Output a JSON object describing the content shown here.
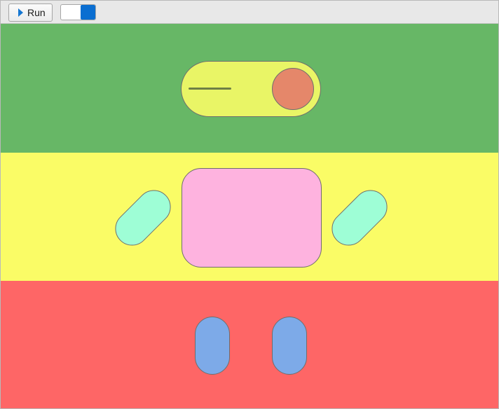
{
  "toolbar": {
    "run_label": "Run",
    "run_icon": "play-icon",
    "toggle_state": "on"
  },
  "colors": {
    "toolbar_bg": "#e8e8e8",
    "play_icon": "#1677d2",
    "toggle_knob": "#0a6ed1",
    "band_top": "#67b766",
    "band_middle": "#fafc66",
    "band_bottom": "#fe6666",
    "switch_body": "#e9f566",
    "switch_line": "#6f7f45",
    "switch_knob": "#e5876a",
    "body_box": "#feb3df",
    "arms": "#9efed6",
    "legs": "#7daae8"
  }
}
